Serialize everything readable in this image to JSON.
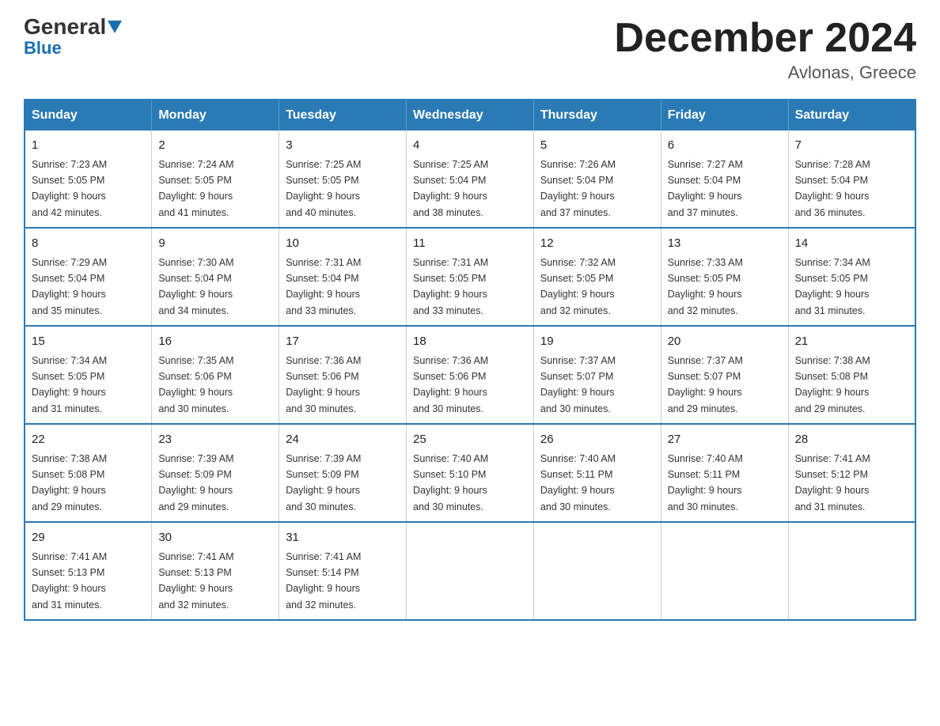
{
  "header": {
    "logo_general": "General",
    "logo_blue": "Blue",
    "month_title": "December 2024",
    "location": "Avlonas, Greece"
  },
  "weekdays": [
    "Sunday",
    "Monday",
    "Tuesday",
    "Wednesday",
    "Thursday",
    "Friday",
    "Saturday"
  ],
  "weeks": [
    [
      {
        "day": "1",
        "sunrise": "7:23 AM",
        "sunset": "5:05 PM",
        "daylight": "9 hours and 42 minutes."
      },
      {
        "day": "2",
        "sunrise": "7:24 AM",
        "sunset": "5:05 PM",
        "daylight": "9 hours and 41 minutes."
      },
      {
        "day": "3",
        "sunrise": "7:25 AM",
        "sunset": "5:05 PM",
        "daylight": "9 hours and 40 minutes."
      },
      {
        "day": "4",
        "sunrise": "7:25 AM",
        "sunset": "5:04 PM",
        "daylight": "9 hours and 38 minutes."
      },
      {
        "day": "5",
        "sunrise": "7:26 AM",
        "sunset": "5:04 PM",
        "daylight": "9 hours and 37 minutes."
      },
      {
        "day": "6",
        "sunrise": "7:27 AM",
        "sunset": "5:04 PM",
        "daylight": "9 hours and 37 minutes."
      },
      {
        "day": "7",
        "sunrise": "7:28 AM",
        "sunset": "5:04 PM",
        "daylight": "9 hours and 36 minutes."
      }
    ],
    [
      {
        "day": "8",
        "sunrise": "7:29 AM",
        "sunset": "5:04 PM",
        "daylight": "9 hours and 35 minutes."
      },
      {
        "day": "9",
        "sunrise": "7:30 AM",
        "sunset": "5:04 PM",
        "daylight": "9 hours and 34 minutes."
      },
      {
        "day": "10",
        "sunrise": "7:31 AM",
        "sunset": "5:04 PM",
        "daylight": "9 hours and 33 minutes."
      },
      {
        "day": "11",
        "sunrise": "7:31 AM",
        "sunset": "5:05 PM",
        "daylight": "9 hours and 33 minutes."
      },
      {
        "day": "12",
        "sunrise": "7:32 AM",
        "sunset": "5:05 PM",
        "daylight": "9 hours and 32 minutes."
      },
      {
        "day": "13",
        "sunrise": "7:33 AM",
        "sunset": "5:05 PM",
        "daylight": "9 hours and 32 minutes."
      },
      {
        "day": "14",
        "sunrise": "7:34 AM",
        "sunset": "5:05 PM",
        "daylight": "9 hours and 31 minutes."
      }
    ],
    [
      {
        "day": "15",
        "sunrise": "7:34 AM",
        "sunset": "5:05 PM",
        "daylight": "9 hours and 31 minutes."
      },
      {
        "day": "16",
        "sunrise": "7:35 AM",
        "sunset": "5:06 PM",
        "daylight": "9 hours and 30 minutes."
      },
      {
        "day": "17",
        "sunrise": "7:36 AM",
        "sunset": "5:06 PM",
        "daylight": "9 hours and 30 minutes."
      },
      {
        "day": "18",
        "sunrise": "7:36 AM",
        "sunset": "5:06 PM",
        "daylight": "9 hours and 30 minutes."
      },
      {
        "day": "19",
        "sunrise": "7:37 AM",
        "sunset": "5:07 PM",
        "daylight": "9 hours and 30 minutes."
      },
      {
        "day": "20",
        "sunrise": "7:37 AM",
        "sunset": "5:07 PM",
        "daylight": "9 hours and 29 minutes."
      },
      {
        "day": "21",
        "sunrise": "7:38 AM",
        "sunset": "5:08 PM",
        "daylight": "9 hours and 29 minutes."
      }
    ],
    [
      {
        "day": "22",
        "sunrise": "7:38 AM",
        "sunset": "5:08 PM",
        "daylight": "9 hours and 29 minutes."
      },
      {
        "day": "23",
        "sunrise": "7:39 AM",
        "sunset": "5:09 PM",
        "daylight": "9 hours and 29 minutes."
      },
      {
        "day": "24",
        "sunrise": "7:39 AM",
        "sunset": "5:09 PM",
        "daylight": "9 hours and 30 minutes."
      },
      {
        "day": "25",
        "sunrise": "7:40 AM",
        "sunset": "5:10 PM",
        "daylight": "9 hours and 30 minutes."
      },
      {
        "day": "26",
        "sunrise": "7:40 AM",
        "sunset": "5:11 PM",
        "daylight": "9 hours and 30 minutes."
      },
      {
        "day": "27",
        "sunrise": "7:40 AM",
        "sunset": "5:11 PM",
        "daylight": "9 hours and 30 minutes."
      },
      {
        "day": "28",
        "sunrise": "7:41 AM",
        "sunset": "5:12 PM",
        "daylight": "9 hours and 31 minutes."
      }
    ],
    [
      {
        "day": "29",
        "sunrise": "7:41 AM",
        "sunset": "5:13 PM",
        "daylight": "9 hours and 31 minutes."
      },
      {
        "day": "30",
        "sunrise": "7:41 AM",
        "sunset": "5:13 PM",
        "daylight": "9 hours and 32 minutes."
      },
      {
        "day": "31",
        "sunrise": "7:41 AM",
        "sunset": "5:14 PM",
        "daylight": "9 hours and 32 minutes."
      },
      null,
      null,
      null,
      null
    ]
  ],
  "labels": {
    "sunrise": "Sunrise:",
    "sunset": "Sunset:",
    "daylight": "Daylight:"
  }
}
